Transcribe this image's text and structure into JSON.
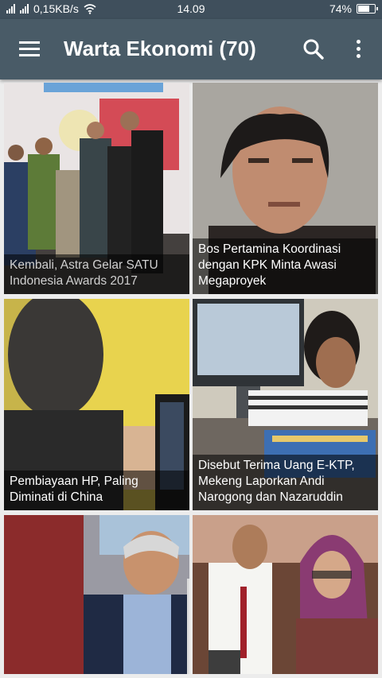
{
  "status_bar": {
    "network_speed": "0,15KB/s",
    "time": "14.09",
    "battery": "74%",
    "battery_level": 0.74,
    "icons": [
      "signal-icon",
      "signal-icon",
      "wifi-icon",
      "battery-icon"
    ]
  },
  "app_bar": {
    "title": "Warta Ekonomi (70)",
    "icons": [
      "menu-icon",
      "search-icon",
      "more-vert-icon"
    ]
  },
  "news": [
    {
      "title": "Kembali, Astra Gelar SATU Indonesia Awards 2017"
    },
    {
      "title": "Bos Pertamina Koordinasi dengan KPK Minta Awasi Megaproyek"
    },
    {
      "title": "Pembiayaan HP, Paling Diminati di China"
    },
    {
      "title": "Disebut Terima Uang E-KTP, Mekeng Laporkan Andi Narogong dan Nazaruddin"
    },
    {
      "title": ""
    },
    {
      "title": ""
    }
  ],
  "colors": {
    "status_bar": "#3f4f5c",
    "app_bar": "#495b67",
    "background": "#ececec"
  }
}
